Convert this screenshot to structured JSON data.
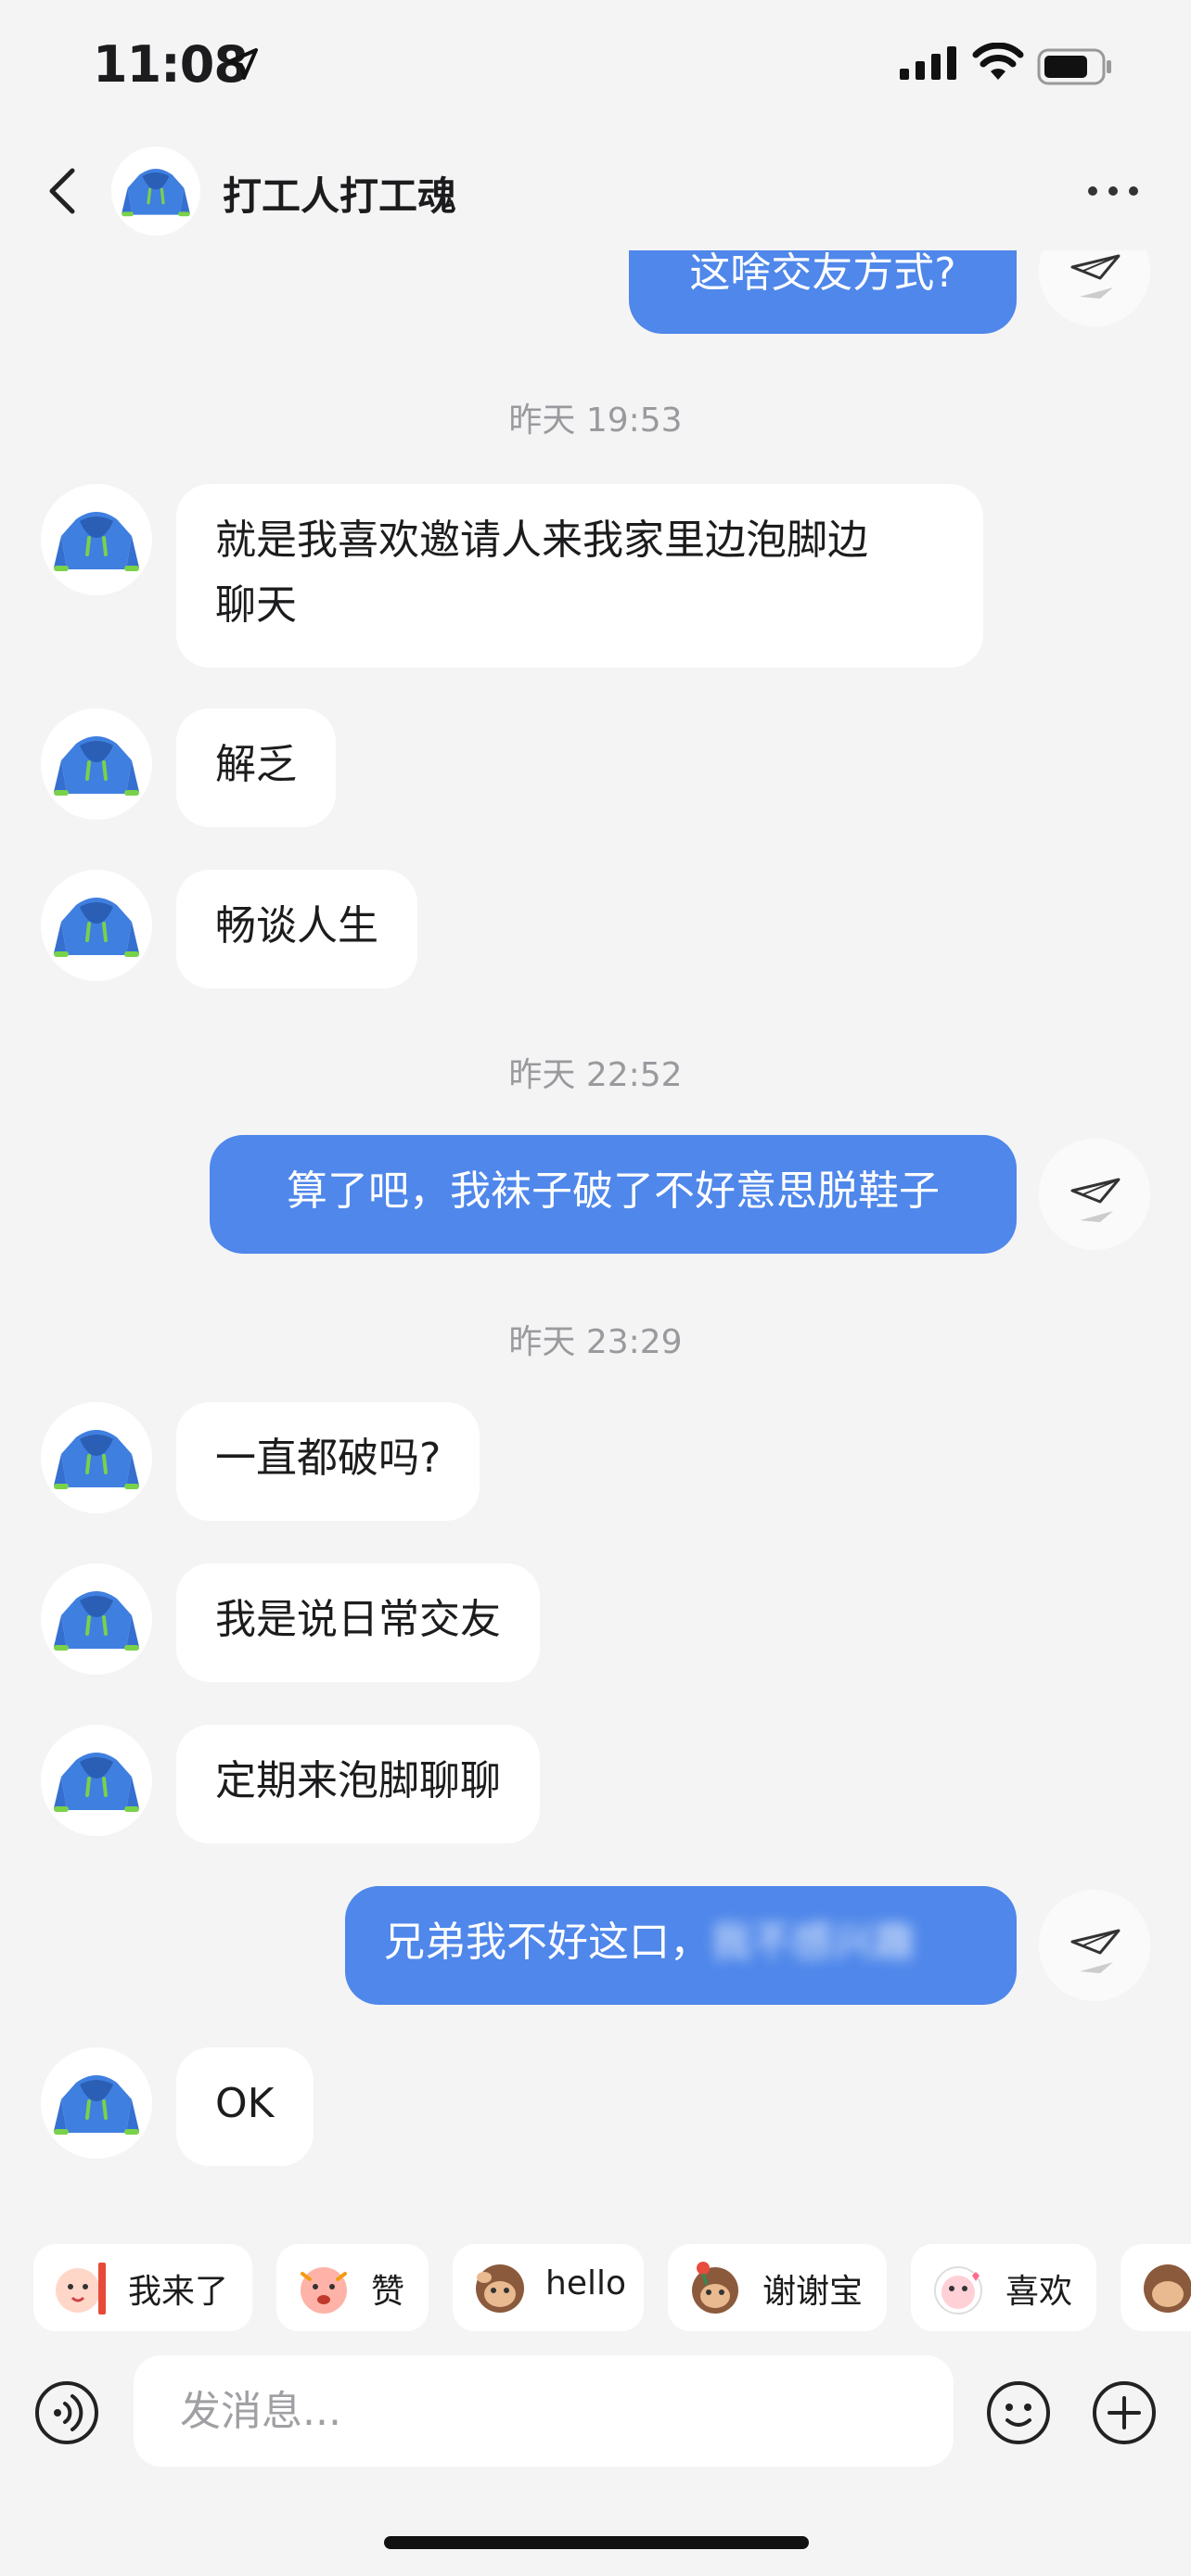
{
  "status_bar": {
    "time": "11:08"
  },
  "header": {
    "title": "打工人打工魂"
  },
  "messages": [
    {
      "type": "out",
      "text": "这啥交友方式?"
    },
    {
      "type": "time",
      "text": "昨天 19:53"
    },
    {
      "type": "in",
      "lines": [
        "就是我喜欢邀请人来我家里边泡脚边",
        "聊天"
      ]
    },
    {
      "type": "in",
      "text": "解乏"
    },
    {
      "type": "in",
      "text": "畅谈人生"
    },
    {
      "type": "time",
      "text": "昨天 22:52"
    },
    {
      "type": "out",
      "text": "算了吧，我袜子破了不好意思脱鞋子"
    },
    {
      "type": "time",
      "text": "昨天 23:29"
    },
    {
      "type": "in",
      "text": "一直都破吗?"
    },
    {
      "type": "in",
      "text": "我是说日常交友"
    },
    {
      "type": "in",
      "text": "定期来泡脚聊聊"
    },
    {
      "type": "out",
      "text": "兄弟我不好这口，",
      "blurred_text": "我不感兴趣"
    },
    {
      "type": "in",
      "text": "OK"
    }
  ],
  "quick_replies": [
    {
      "label": "我来了",
      "icon": "sticker-icon"
    },
    {
      "label": "赞",
      "icon": "sticker-icon"
    },
    {
      "label": "hello",
      "icon": "monkey-sticker-icon"
    },
    {
      "label": "谢谢宝",
      "icon": "monkey-rose-sticker-icon"
    },
    {
      "label": "喜欢",
      "icon": "sticker-icon"
    }
  ],
  "composer": {
    "placeholder": "发消息..."
  },
  "colors": {
    "outgoing_bubble": "#4f87ea",
    "incoming_bubble": "#ffffff",
    "background": "#f4f4f5"
  }
}
